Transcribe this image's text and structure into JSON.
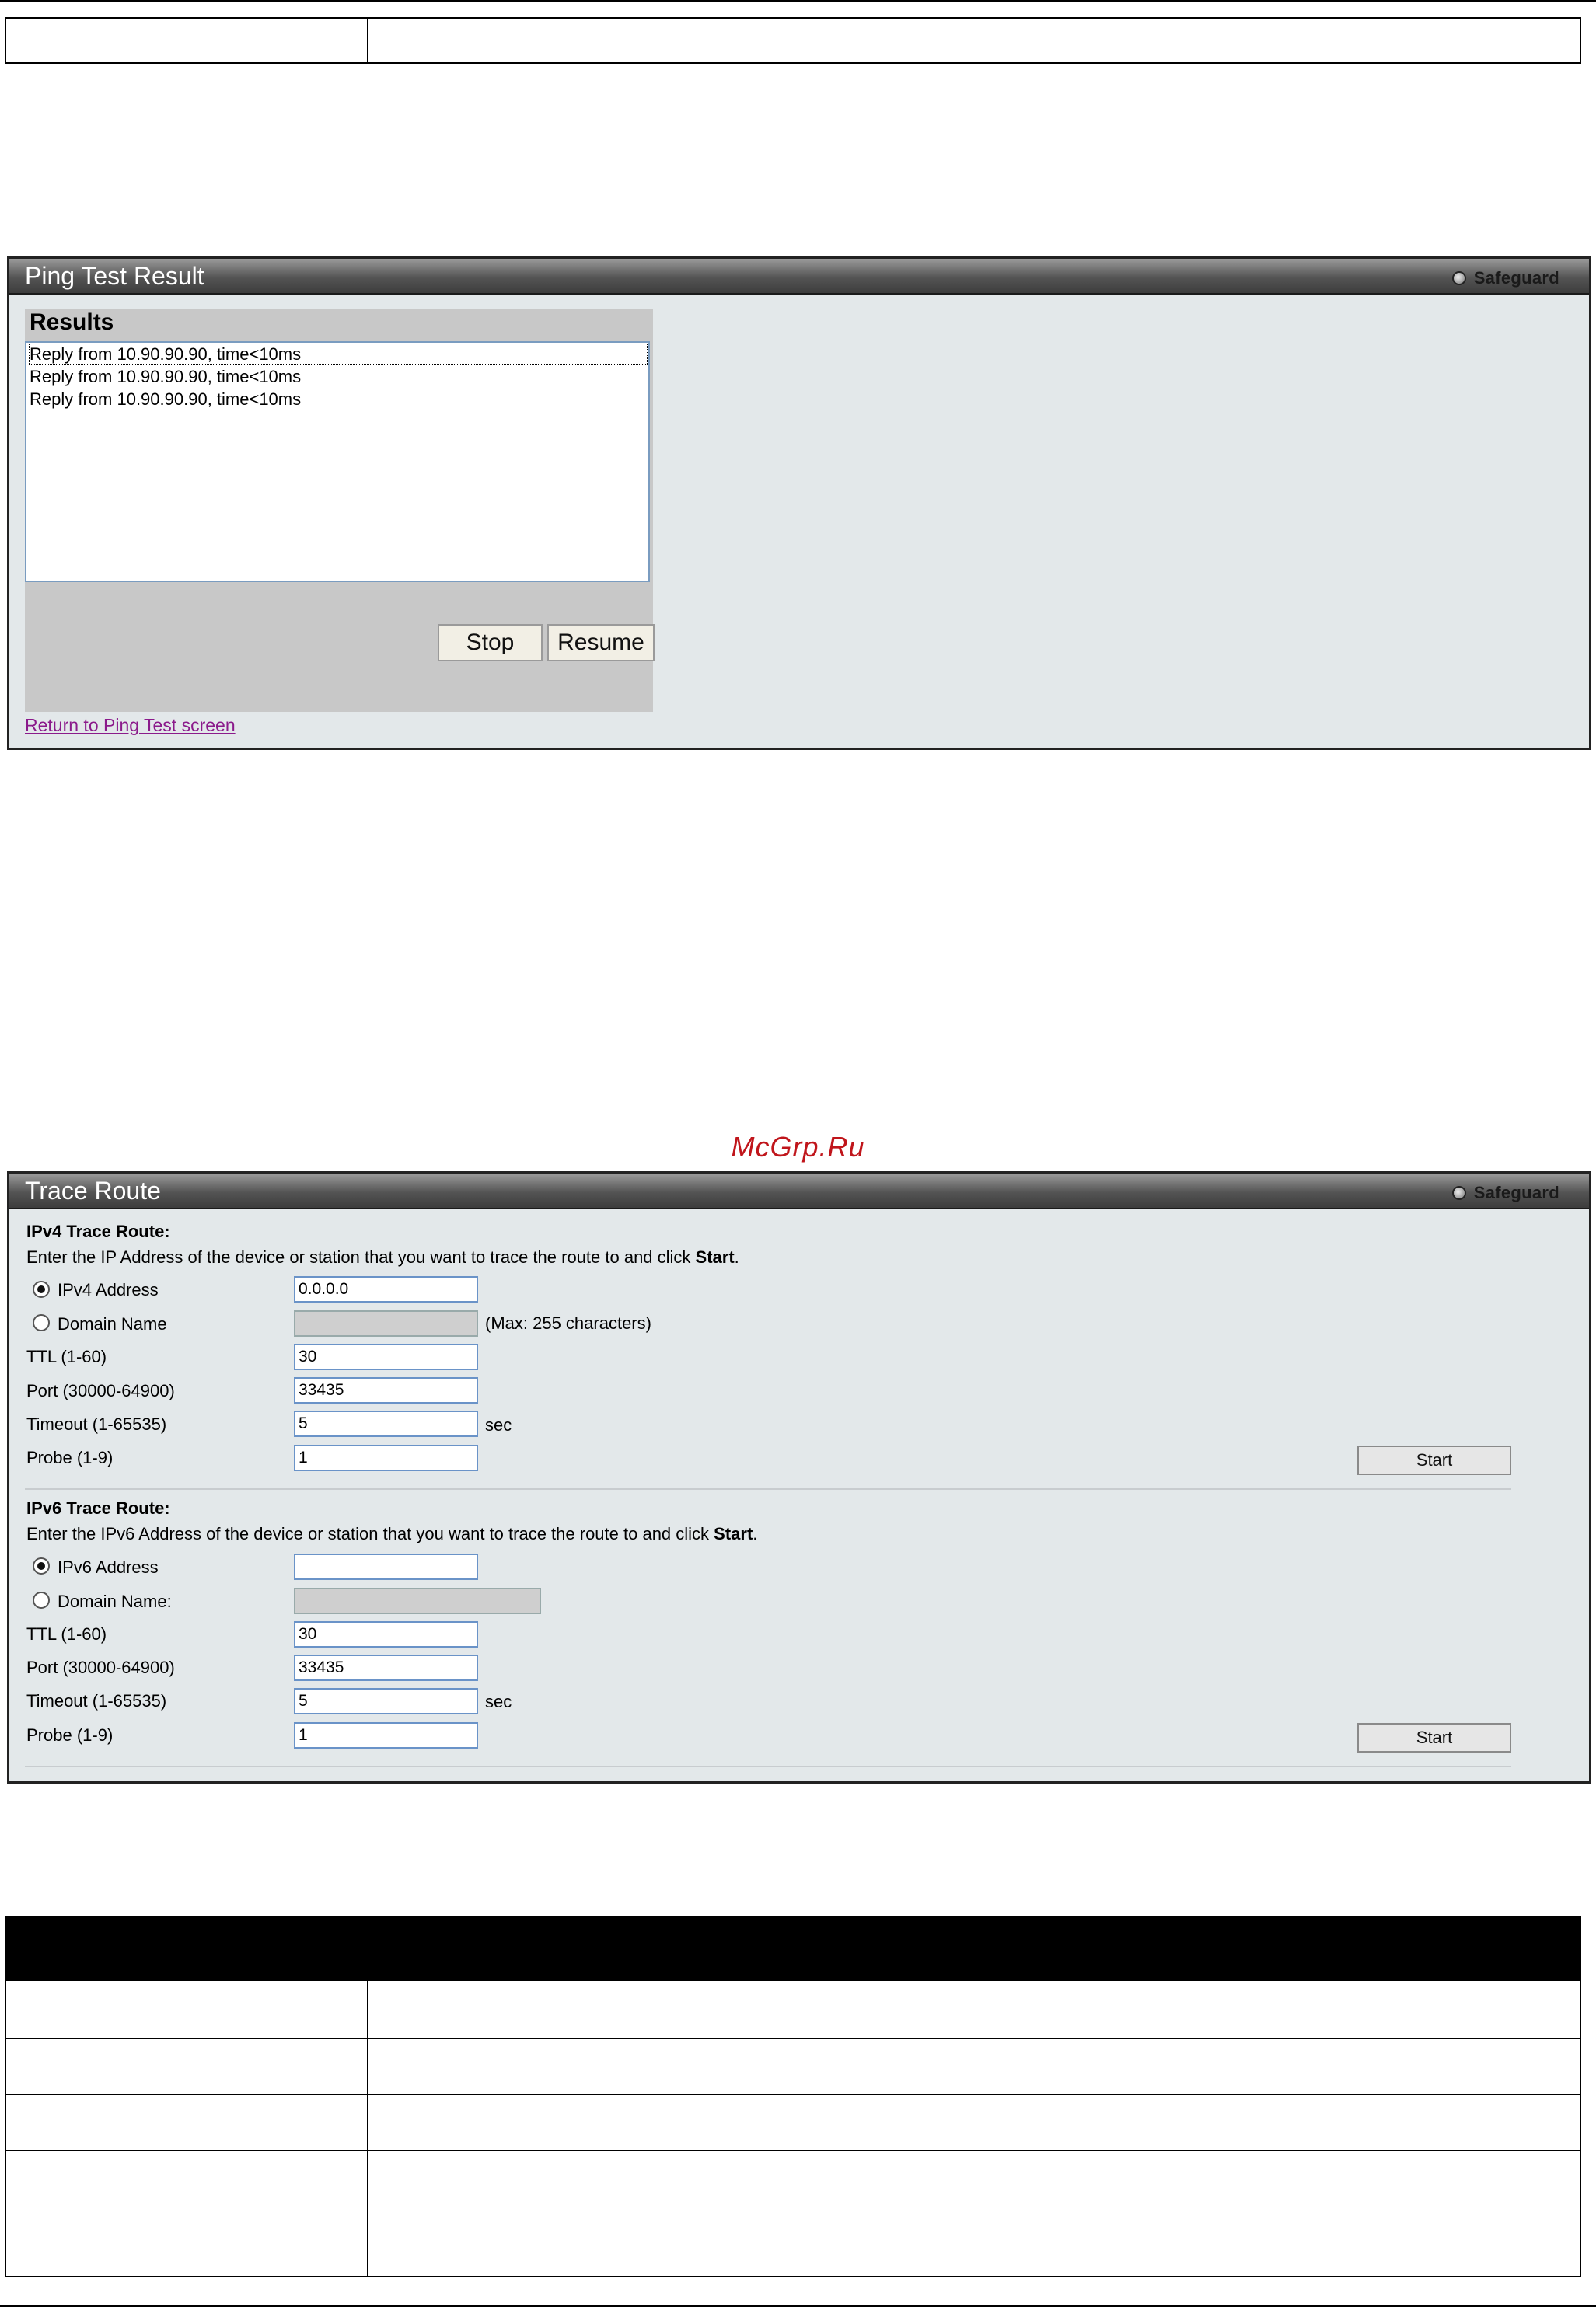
{
  "ping_panel": {
    "title": "Ping Test Result",
    "badge": "Safeguard",
    "results_label": "Results",
    "results": [
      "Reply from 10.90.90.90, time<10ms",
      "Reply from 10.90.90.90, time<10ms",
      "Reply from 10.90.90.90, time<10ms"
    ],
    "stop_label": "Stop",
    "resume_label": "Resume",
    "return_link": "Return to Ping Test screen"
  },
  "watermark": "McGrp.Ru",
  "trace_panel": {
    "title": "Trace Route",
    "badge": "Safeguard",
    "ipv4": {
      "heading": "IPv4 Trace Route:",
      "instruction_prefix": "Enter the IP Address of the device or station that you want to trace the route to and click ",
      "instruction_bold": "Start",
      "instruction_suffix": ".",
      "address_label": "IPv4 Address",
      "address_value": "0.0.0.0",
      "address_selected": true,
      "domain_label": "Domain Name",
      "domain_value": "",
      "domain_hint": "(Max: 255 characters)",
      "ttl_label": "TTL (1-60)",
      "ttl_value": "30",
      "port_label": "Port (30000-64900)",
      "port_value": "33435",
      "timeout_label": "Timeout (1-65535)",
      "timeout_value": "5",
      "timeout_unit": "sec",
      "probe_label": "Probe (1-9)",
      "probe_value": "1",
      "start_label": "Start"
    },
    "ipv6": {
      "heading": "IPv6 Trace Route:",
      "instruction_prefix": "Enter the IPv6 Address of the device or station that you want to trace the route to and click ",
      "instruction_bold": "Start",
      "instruction_suffix": ".",
      "address_label": "IPv6 Address",
      "address_value": "",
      "address_selected": true,
      "domain_label": "Domain Name:",
      "domain_value": "",
      "ttl_label": "TTL (1-60)",
      "ttl_value": "30",
      "port_label": "Port (30000-64900)",
      "port_value": "33435",
      "timeout_label": "Timeout (1-65535)",
      "timeout_value": "5",
      "timeout_unit": "sec",
      "probe_label": "Probe (1-9)",
      "probe_value": "1",
      "start_label": "Start"
    }
  }
}
